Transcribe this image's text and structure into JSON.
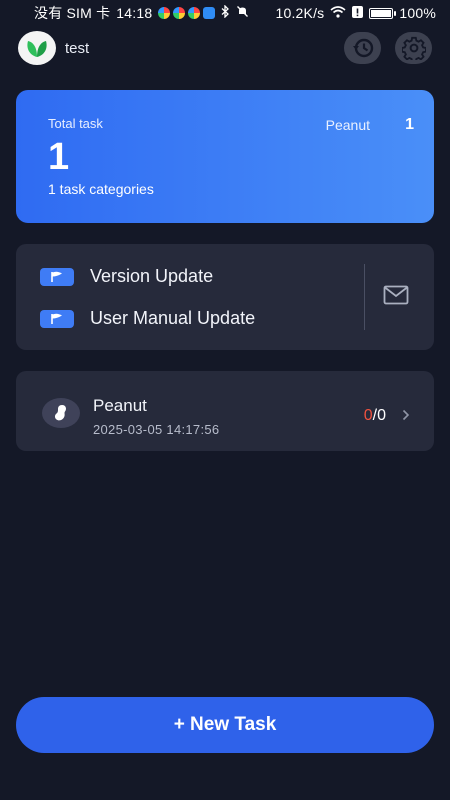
{
  "status_bar": {
    "carrier": "没有 SIM 卡",
    "time": "14:18",
    "speed": "10.2K/s",
    "battery": "100%"
  },
  "header": {
    "app_name": "test",
    "history_icon": "history-icon",
    "settings_icon": "gear-icon"
  },
  "summary": {
    "total_label": "Total task",
    "total_value": "1",
    "categories_text": "1 task categories",
    "owner_name": "Peanut",
    "owner_count": "1"
  },
  "task_categories": [
    {
      "label": "Version Update",
      "icon": "flag-icon"
    },
    {
      "label": "User Manual Update",
      "icon": "flag-icon"
    }
  ],
  "project": {
    "name": "Peanut",
    "date": "2025-03-05 14:17:56",
    "completed": "0",
    "separator": "/",
    "total": "0"
  },
  "actions": {
    "new_task_label": "+ New Task"
  },
  "colors": {
    "background": "#141827",
    "card": "#262a3b",
    "accent": "#2f62ea",
    "progress_done": "#f0523f"
  }
}
